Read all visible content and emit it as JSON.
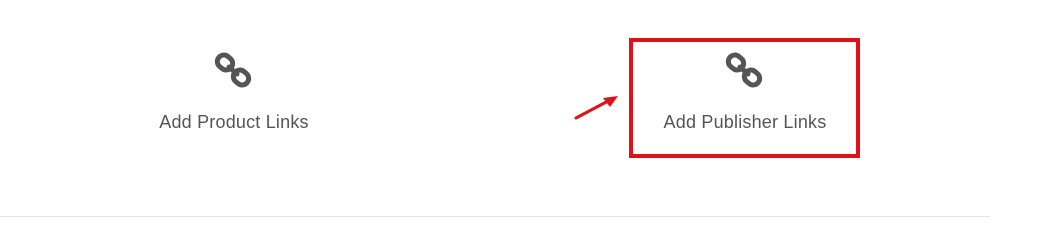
{
  "links": {
    "product": {
      "label": "Add Product Links",
      "icon": "chain-link-icon"
    },
    "publisher": {
      "label": "Add Publisher Links",
      "icon": "chain-link-icon"
    }
  },
  "annotation": {
    "highlight_color": "#e01219",
    "arrow_color": "#e01219"
  },
  "colors": {
    "text": "#555555",
    "icon": "#555555",
    "divider": "#e4e4e4"
  }
}
